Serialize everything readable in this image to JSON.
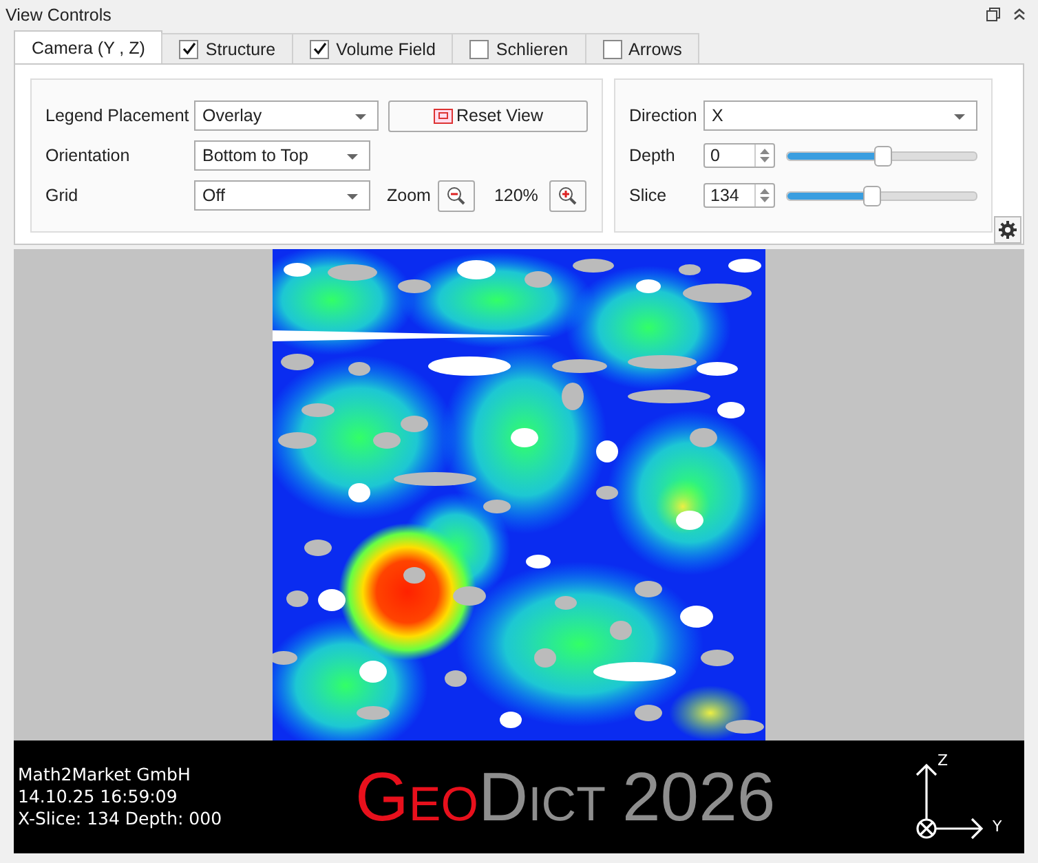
{
  "panel": {
    "title": "View Controls"
  },
  "tabs": [
    {
      "label": "Camera (Y , Z)",
      "selected": true,
      "kind": "plain"
    },
    {
      "label": "Structure",
      "selected": false,
      "kind": "checkbox",
      "checked": true
    },
    {
      "label": "Volume Field",
      "selected": false,
      "kind": "checkbox",
      "checked": true
    },
    {
      "label": "Schlieren",
      "selected": false,
      "kind": "checkbox",
      "checked": false
    },
    {
      "label": "Arrows",
      "selected": false,
      "kind": "checkbox",
      "checked": false
    }
  ],
  "camera": {
    "legend_placement": {
      "label": "Legend Placement",
      "value": "Overlay"
    },
    "reset_button": "Reset View",
    "orientation": {
      "label": "Orientation",
      "value": "Bottom to Top"
    },
    "grid": {
      "label": "Grid",
      "value": "Off"
    },
    "zoom": {
      "label": "Zoom",
      "value": "120%"
    }
  },
  "slicing": {
    "direction": {
      "label": "Direction",
      "value": "X"
    },
    "depth": {
      "label": "Depth",
      "value": "0",
      "level": 0.51
    },
    "slice": {
      "label": "Slice",
      "value": "134",
      "level": 0.45
    }
  },
  "viewer": {
    "info_lines": [
      "Math2Market GmbH",
      "14.10.25 16:59:09",
      "X-Slice: 134 Depth: 000"
    ],
    "logo": {
      "brand": "Geo",
      "product": "Dict",
      "version": "2026"
    },
    "axes": {
      "up": "Z",
      "right": "Y"
    }
  }
}
